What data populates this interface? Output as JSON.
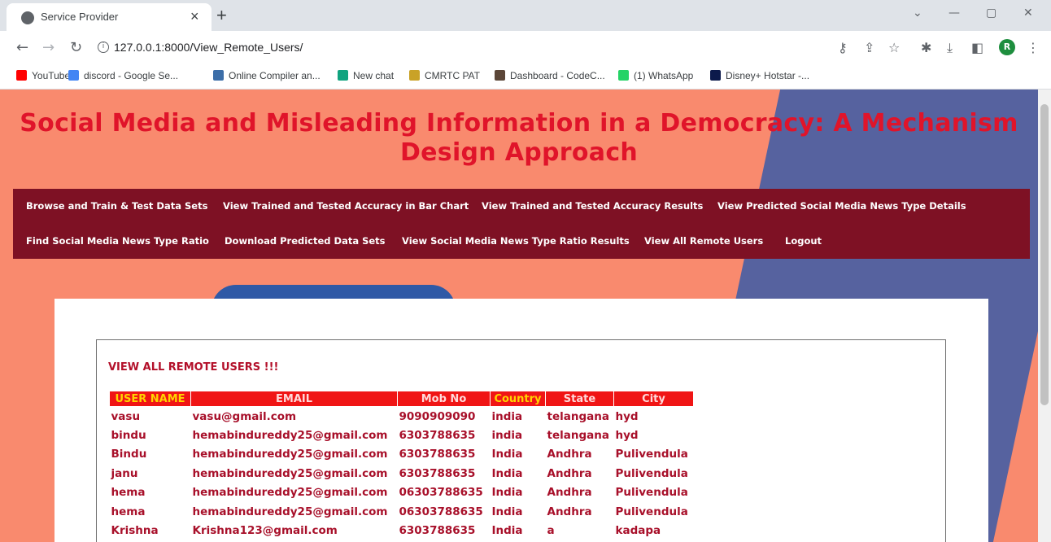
{
  "browser": {
    "tab_title": "Service Provider",
    "tab_close": "×",
    "new_tab": "+",
    "url": "127.0.0.1:8000/View_Remote_Users/",
    "profile_initial": "R",
    "window_controls": [
      "⌄",
      "—",
      "▢",
      "✕"
    ]
  },
  "bookmarks": [
    {
      "label": "YouTube",
      "icon": "youtube-icon",
      "color": "#ff0000"
    },
    {
      "label": "discord - Google Se...",
      "icon": "google-icon",
      "color": "#4285f4"
    },
    {
      "label": "Online Compiler an...",
      "icon": "compiler-icon",
      "color": "#3c6ea8"
    },
    {
      "label": "New chat",
      "icon": "chatgpt-icon",
      "color": "#10a37f"
    },
    {
      "label": "CMRTC PAT",
      "icon": "cmrtc-icon",
      "color": "#c9a227"
    },
    {
      "label": "Dashboard - CodeC...",
      "icon": "codechef-icon",
      "color": "#5b4638"
    },
    {
      "label": "(1) WhatsApp",
      "icon": "whatsapp-icon",
      "color": "#25d366"
    },
    {
      "label": "Disney+ Hotstar -...",
      "icon": "hotstar-icon",
      "color": "#0c1a4b"
    }
  ],
  "site": {
    "title_line1": "Social Media and Misleading Information in a Democracy: A Mechanism",
    "title_line2": "Design Approach",
    "menu_row1": [
      "Browse and Train & Test Data Sets",
      "View Trained and Tested Accuracy in Bar Chart",
      "View Trained and Tested Accuracy Results",
      "View Predicted Social Media News Type Details"
    ],
    "menu_row2": [
      "Find Social Media News Type Ratio",
      "Download Predicted Data Sets",
      "View Social Media News Type Ratio Results",
      "View All Remote Users",
      "Logout"
    ]
  },
  "users_table": {
    "heading": "VIEW ALL REMOTE USERS !!!",
    "columns": [
      "USER NAME",
      "EMAIL",
      "Mob No",
      "Country",
      "State",
      "City"
    ],
    "rows": [
      [
        "vasu",
        "vasu@gmail.com",
        "9090909090",
        "india",
        "telangana",
        "hyd"
      ],
      [
        "bindu",
        "hemabindureddy25@gmail.com",
        "6303788635",
        "india",
        "telangana",
        "hyd"
      ],
      [
        "Bindu",
        "hemabindureddy25@gmail.com",
        "6303788635",
        "India",
        "Andhra",
        "Pulivendula"
      ],
      [
        "janu",
        "hemabindureddy25@gmail.com",
        "6303788635",
        "India",
        "Andhra",
        "Pulivendula"
      ],
      [
        "hema",
        "hemabindureddy25@gmail.com",
        "06303788635",
        "India",
        "Andhra",
        "Pulivendula"
      ],
      [
        "hema",
        "hemabindureddy25@gmail.com",
        "06303788635",
        "India",
        "Andhra",
        "Pulivendula"
      ],
      [
        "Krishna",
        "Krishna123@gmail.com",
        "6303788635",
        "India",
        "a",
        "kadapa"
      ]
    ]
  }
}
